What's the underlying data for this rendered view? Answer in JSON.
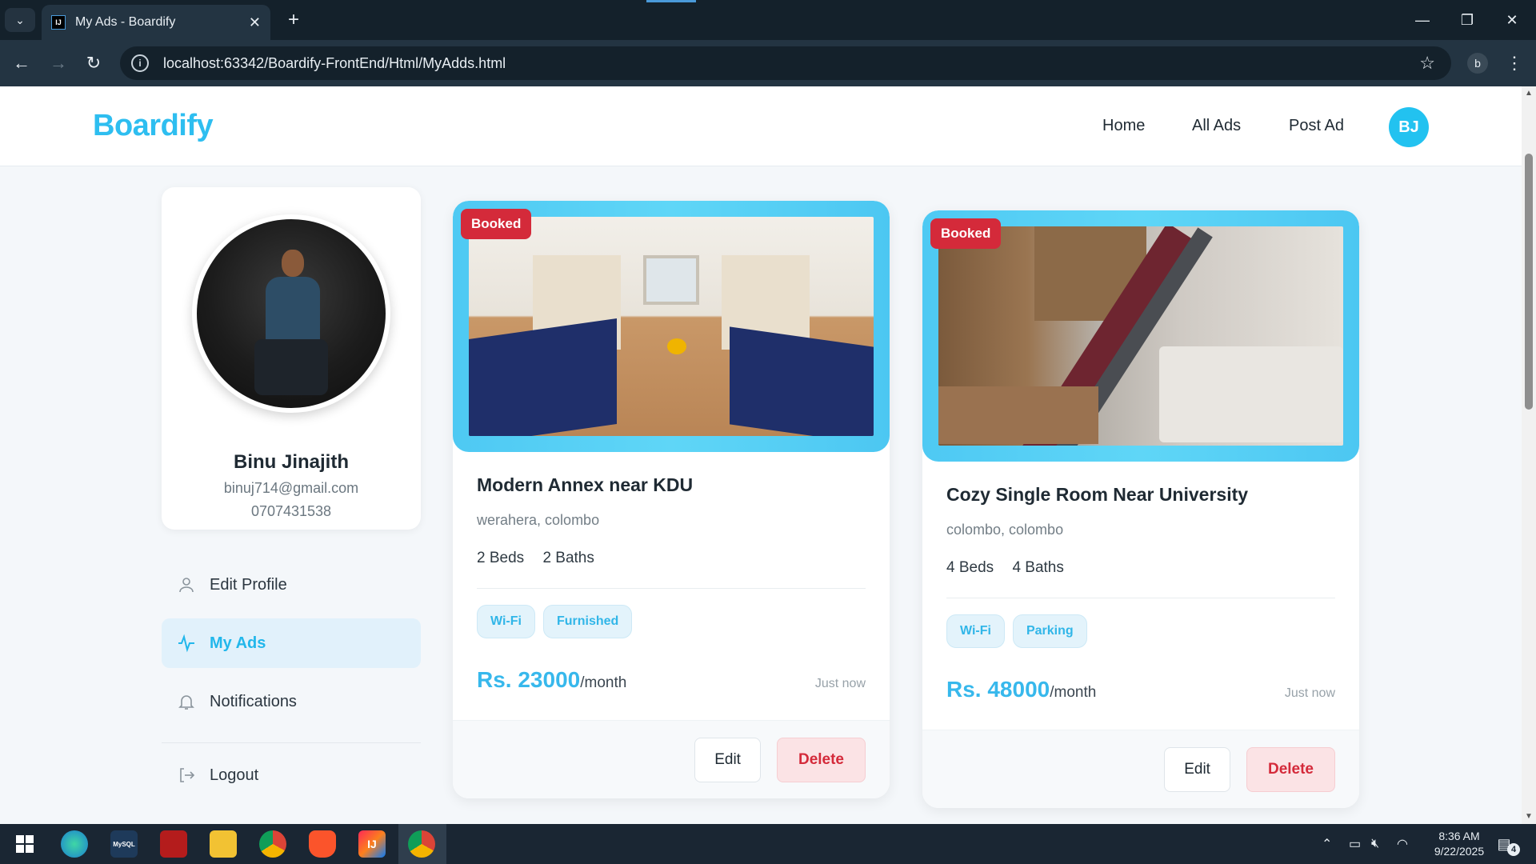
{
  "browser": {
    "tab_title": "My Ads - Boardify",
    "tab_favicon": "IJ",
    "url": "localhost:63342/Boardify-FrontEnd/Html/MyAdds.html",
    "profile_initial": "b",
    "icons": {
      "tab_dropdown": "chevron-down-icon",
      "close": "close-icon",
      "new_tab": "plus-icon",
      "back": "arrow-left-icon",
      "forward": "arrow-right-icon",
      "reload": "reload-icon",
      "info": "info-icon",
      "bookmark": "star-icon",
      "menu": "kebab-menu-icon"
    }
  },
  "site": {
    "logo": "Boardify",
    "nav": [
      "Home",
      "All Ads",
      "Post Ad"
    ],
    "avatar_initials": "BJ",
    "brand_color": "#2ebef0"
  },
  "profile": {
    "name": "Binu Jinajith",
    "email": "binuj714@gmail.com",
    "phone": "0707431538"
  },
  "sidebar": {
    "items": [
      {
        "label": "Edit Profile",
        "icon": "user-icon"
      },
      {
        "label": "My Ads",
        "icon": "activity-icon",
        "active": true
      },
      {
        "label": "Notifications",
        "icon": "bell-icon"
      },
      {
        "label": "Logout",
        "icon": "logout-icon"
      }
    ]
  },
  "ads": [
    {
      "badge": "Booked",
      "title": "Modern Annex near KDU",
      "location": "werahera, colombo",
      "beds": "2 Beds",
      "baths": "2 Baths",
      "tags": [
        "Wi-Fi",
        "Furnished"
      ],
      "price": "Rs. 23000",
      "per": "/month",
      "posted": "Just now",
      "edit_label": "Edit",
      "delete_label": "Delete"
    },
    {
      "badge": "Booked",
      "title": "Cozy Single Room Near University",
      "location": "colombo, colombo",
      "beds": "4 Beds",
      "baths": "4 Baths",
      "tags": [
        "Wi-Fi",
        "Parking"
      ],
      "price": "Rs. 48000",
      "per": "/month",
      "posted": "Just now",
      "edit_label": "Edit",
      "delete_label": "Delete"
    }
  ],
  "taskbar": {
    "time": "8:36 AM",
    "date": "9/22/2025",
    "notification_count": "4",
    "mysql_label": "MySQL",
    "intellij_label": "IJ"
  }
}
